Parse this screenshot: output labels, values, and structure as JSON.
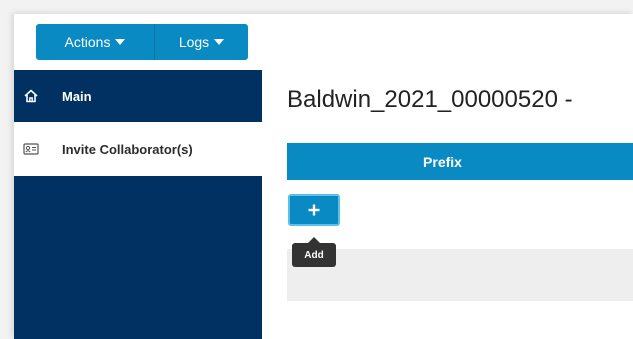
{
  "toolbar": {
    "actions_label": "Actions",
    "logs_label": "Logs"
  },
  "sidebar": {
    "items": [
      {
        "label": "Main",
        "icon": "home-icon"
      },
      {
        "label": "Invite Collaborator(s)",
        "icon": "contact-card-icon"
      }
    ]
  },
  "main": {
    "title": "Baldwin_2021_00000520 -",
    "table": {
      "columns": [
        "Prefix"
      ]
    },
    "add_button_label": "+",
    "add_tooltip": "Add"
  },
  "colors": {
    "accent": "#0a8ac2",
    "sidebar": "#003162",
    "tooltip": "#333333"
  }
}
